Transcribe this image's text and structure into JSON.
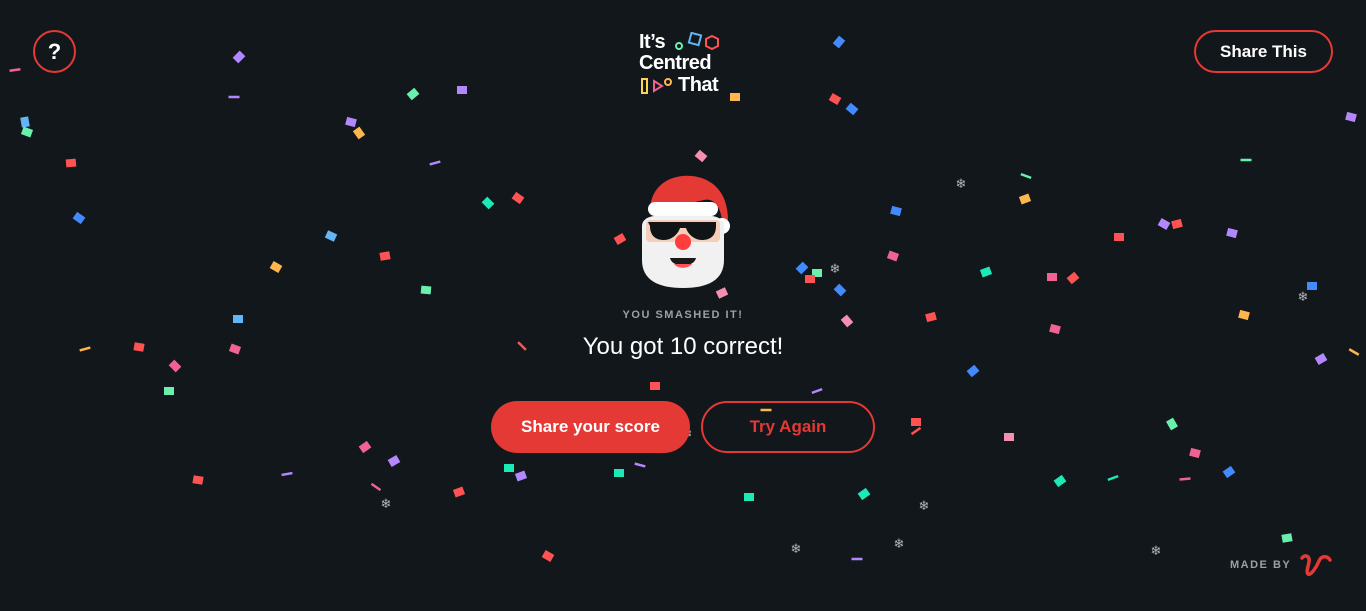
{
  "header": {
    "help_label": "?",
    "share_label": "Share This",
    "logo_lines": [
      "It’s",
      "Centred",
      "That"
    ]
  },
  "result": {
    "kicker": "YOU SMASHED IT!",
    "headline": "You got 10 correct!"
  },
  "actions": {
    "share_score_label": "Share your score",
    "try_again_label": "Try Again"
  },
  "footer": {
    "made_by_label": "MADE BY"
  },
  "colors": {
    "background": "#11171a",
    "accent": "#e53935",
    "muted_text": "#9aa0a4",
    "confetti": [
      "#f06292",
      "#ff5252",
      "#ffb74d",
      "#69f0ae",
      "#1de9b6",
      "#448aff",
      "#b388ff",
      "#64b5f6",
      "#ffd54f",
      "#f48fb1"
    ]
  },
  "icons": {
    "help": "question-mark-icon",
    "santa": "santa-sunglasses-icon",
    "made_by_logo": "swoosh-logo-icon",
    "snowflake": "snowflake-icon"
  }
}
